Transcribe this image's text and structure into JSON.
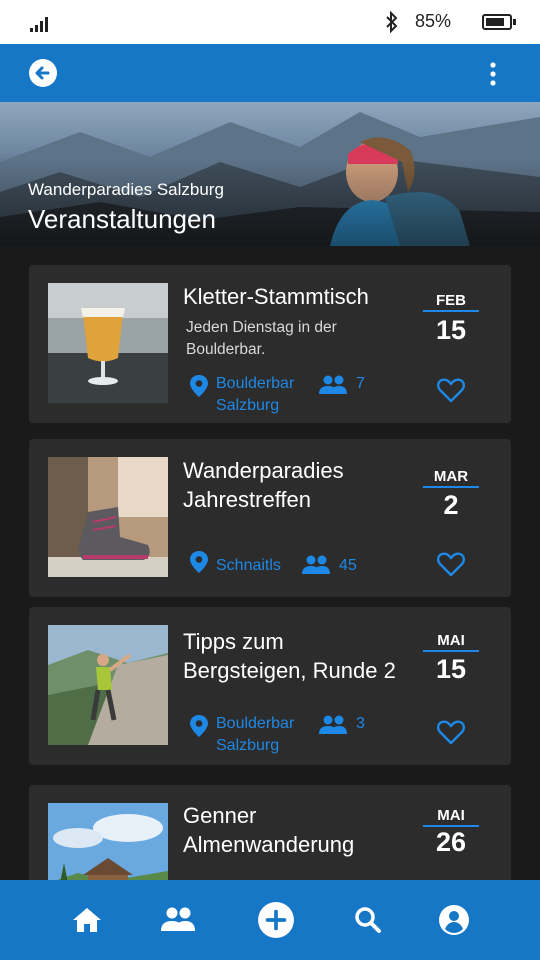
{
  "status_bar": {
    "battery_percent": "85%"
  },
  "app_bar": {
    "back_icon": "arrow-left-circle-icon",
    "menu_icon": "more-vertical-icon"
  },
  "hero": {
    "subtitle": "Wanderparadies Salzburg",
    "title": "Veranstaltungen"
  },
  "events": [
    {
      "title_lines": [
        "Kletter-Stammtisch"
      ],
      "description_lines": [
        "Jeden Dienstag in der",
        "Boulderbar."
      ],
      "location_lines": [
        "Boulderbar",
        "Salzburg"
      ],
      "attendees": "7",
      "month": "FEB",
      "day": "15"
    },
    {
      "title_lines": [
        "Wanderparadies",
        "Jahrestreffen"
      ],
      "description_lines": [],
      "location_lines": [
        "Schnaitls"
      ],
      "attendees": "45",
      "month": "MAR",
      "day": "2"
    },
    {
      "title_lines": [
        "Tipps zum",
        "Bergsteigen, Runde 2"
      ],
      "description_lines": [],
      "location_lines": [
        "Boulderbar",
        "Salzburg"
      ],
      "attendees": "3",
      "month": "MAI",
      "day": "15"
    },
    {
      "title_lines": [
        "Genner",
        "Almenwanderung"
      ],
      "description_lines": [],
      "location_lines": [],
      "attendees": "",
      "month": "MAI",
      "day": "26"
    }
  ],
  "bottom_nav": {
    "items": [
      "home-icon",
      "group-icon",
      "add-circle-icon",
      "search-icon",
      "account-circle-icon"
    ]
  },
  "colors": {
    "primary": "#1677c7",
    "accent": "#1e88e5",
    "card": "#2c2c2c",
    "background": "#1a1a1a"
  }
}
